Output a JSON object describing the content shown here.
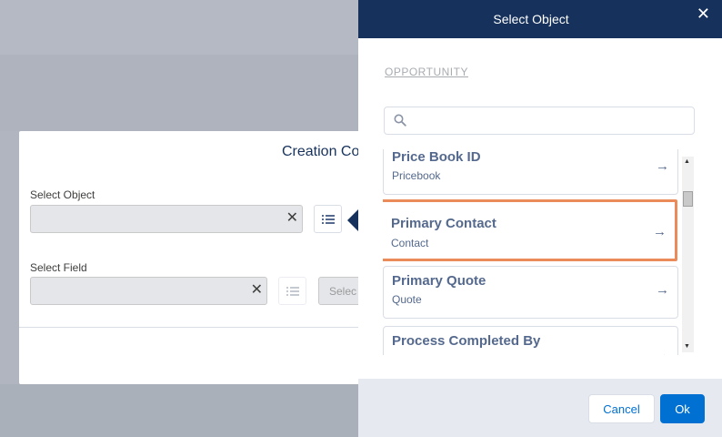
{
  "base_modal": {
    "title": "Creation Co",
    "select_object_label": "Select Object",
    "select_field_label": "Select Field",
    "select_button_label": "Selec"
  },
  "panel": {
    "title": "Select Object",
    "breadcrumb": "OPPORTUNITY",
    "search": {
      "value": "",
      "placeholder": ""
    },
    "items": [
      {
        "title": "Price Book ID",
        "subtitle": "Pricebook"
      },
      {
        "title": "Primary Contact",
        "subtitle": "Contact",
        "selected": true
      },
      {
        "title": "Primary Quote",
        "subtitle": "Quote"
      },
      {
        "title": "Process Completed By",
        "subtitle": ""
      }
    ],
    "cancel_label": "Cancel",
    "ok_label": "Ok"
  },
  "icons": {
    "close": "close-icon",
    "clear": "clear-icon",
    "list": "list-icon",
    "search": "search-icon",
    "arrow": "arrow-right-icon"
  },
  "colors": {
    "header": "#16325c",
    "brand": "#0070d2",
    "highlight": "#ec8b5a",
    "item_text": "#54698d"
  }
}
